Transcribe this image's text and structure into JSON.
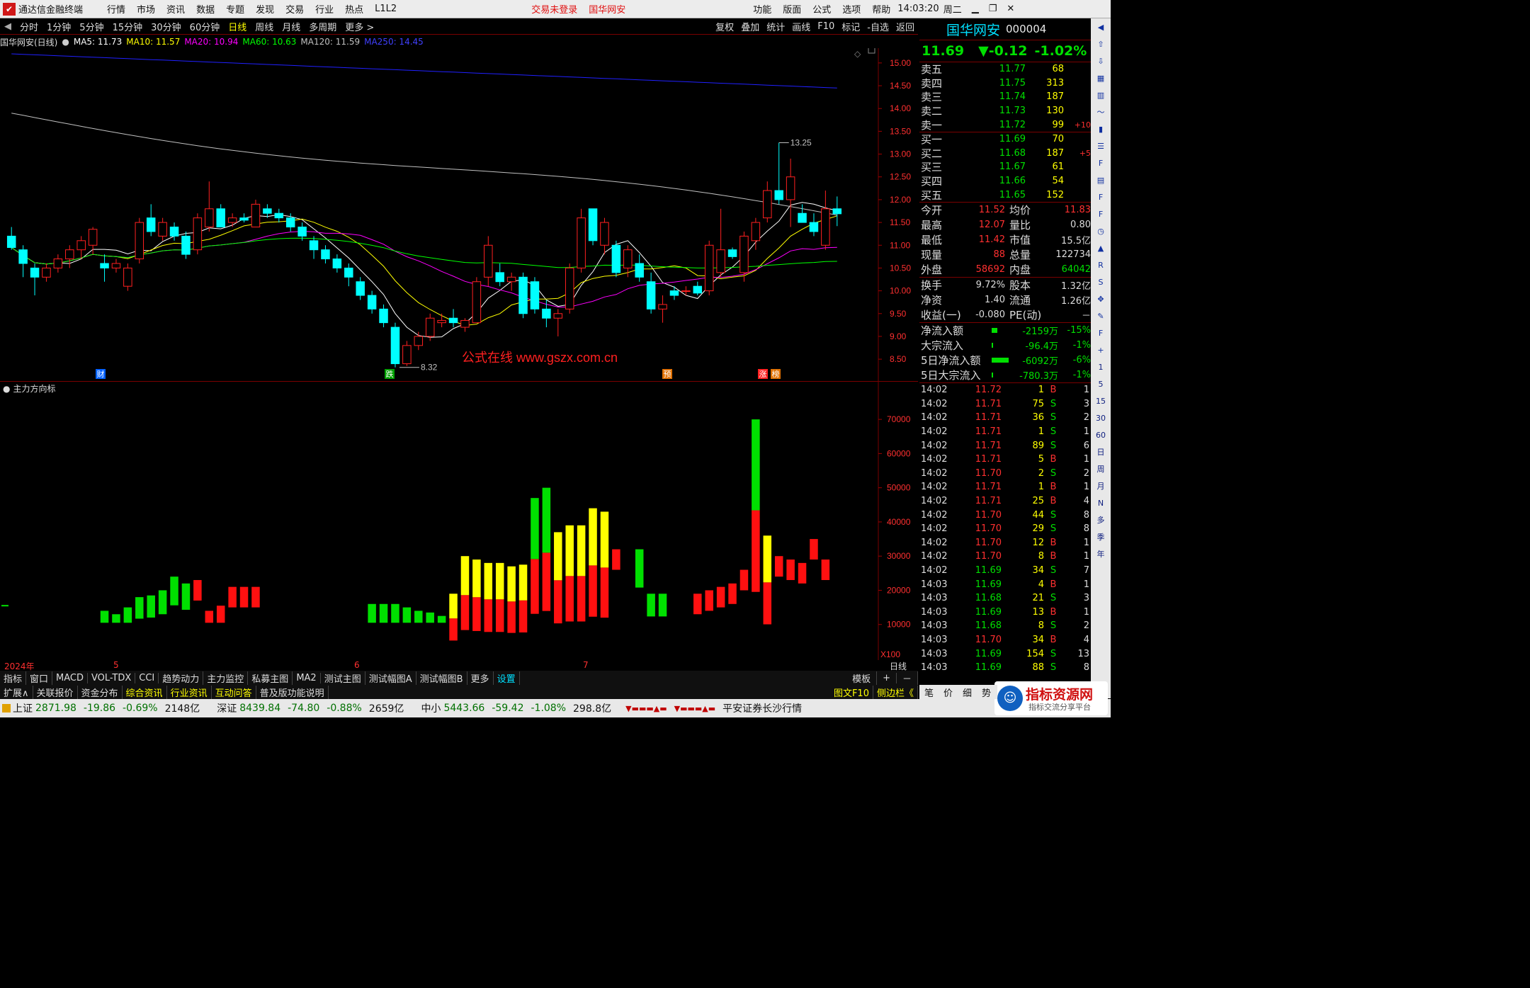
{
  "menubar": {
    "app_title": "通达信金融终端",
    "items": [
      "行情",
      "市场",
      "资讯",
      "数据",
      "专题",
      "发现",
      "交易",
      "行业",
      "热点",
      "L1L2"
    ],
    "warn1": "交易未登录",
    "warn2": "国华网安",
    "right_items": [
      "功能",
      "版面",
      "公式",
      "选项",
      "帮助"
    ],
    "time": "14:03:20",
    "weekday": "周二"
  },
  "toolbar": {
    "periods": [
      "分时",
      "1分钟",
      "5分钟",
      "15分钟",
      "30分钟",
      "60分钟",
      "日线",
      "周线",
      "月线",
      "多周期",
      "更多 >"
    ],
    "active": "日线",
    "right": [
      "复权",
      "叠加",
      "统计",
      "画线",
      "F10",
      "标记",
      "-自选",
      "返回"
    ]
  },
  "ma_line": {
    "title": "国华网安(日线)",
    "ma5": "MA5: 11.73",
    "ma10": "MA10: 11.57",
    "ma20": "MA20: 10.94",
    "ma60": "MA60: 10.63",
    "ma120": "MA120: 11.59",
    "ma250": "MA250: 14.45"
  },
  "colors": {
    "ma5": "#ffffff",
    "ma10": "#ffff00",
    "ma20": "#ff00ff",
    "ma60": "#00ff00",
    "ma120": "#c0c0c0",
    "ma250": "#2020ff",
    "up": "#ff2020",
    "down": "#00ffff"
  },
  "annotations": {
    "high": "13.25",
    "low": "8.32",
    "watermark": "公式在线  www.gszx.com.cn",
    "events": [
      "财",
      "跌",
      "预",
      "涨",
      "榜"
    ]
  },
  "price_axis": [
    "15.00",
    "14.50",
    "14.00",
    "13.50",
    "13.00",
    "12.50",
    "12.00",
    "11.50",
    "11.00",
    "10.50",
    "10.00",
    "9.50",
    "9.00",
    "8.50"
  ],
  "indicator": {
    "title": "主力方向标",
    "axis": [
      "70000",
      "60000",
      "50000",
      "40000",
      "30000",
      "20000",
      "10000"
    ],
    "multiplier": "X100"
  },
  "date_axis": [
    "2024年",
    "5",
    "6",
    "7"
  ],
  "date_axis_right": "日线",
  "stock": {
    "name": "国华网安",
    "code": "000004",
    "price": "11.69",
    "change": "▼-0.12",
    "pct": "-1.02%"
  },
  "asks": [
    {
      "label": "卖五",
      "price": "11.77",
      "vol": "68",
      "chg": ""
    },
    {
      "label": "卖四",
      "price": "11.75",
      "vol": "313",
      "chg": ""
    },
    {
      "label": "卖三",
      "price": "11.74",
      "vol": "187",
      "chg": ""
    },
    {
      "label": "卖二",
      "price": "11.73",
      "vol": "130",
      "chg": ""
    },
    {
      "label": "卖一",
      "price": "11.72",
      "vol": "99",
      "chg": "+10"
    }
  ],
  "bids": [
    {
      "label": "买一",
      "price": "11.69",
      "vol": "70",
      "chg": ""
    },
    {
      "label": "买二",
      "price": "11.68",
      "vol": "187",
      "chg": "+5"
    },
    {
      "label": "买三",
      "price": "11.67",
      "vol": "61",
      "chg": ""
    },
    {
      "label": "买四",
      "price": "11.66",
      "vol": "54",
      "chg": ""
    },
    {
      "label": "买五",
      "price": "11.65",
      "vol": "152",
      "chg": ""
    }
  ],
  "stats": [
    {
      "l1": "今开",
      "v1": "11.52",
      "l2": "均价",
      "v2": "11.83"
    },
    {
      "l1": "最高",
      "v1": "12.07",
      "l2": "量比",
      "v2": "0.80"
    },
    {
      "l1": "最低",
      "v1": "11.42",
      "l2": "市值",
      "v2": "15.5亿"
    },
    {
      "l1": "现量",
      "v1": "88",
      "l2": "总量",
      "v2": "122734"
    },
    {
      "l1": "外盘",
      "v1": "58692",
      "l2": "内盘",
      "v2": "64042"
    }
  ],
  "stats2": [
    {
      "l1": "换手",
      "v1": "9.72%",
      "l2": "股本",
      "v2": "1.32亿"
    },
    {
      "l1": "净资",
      "v1": "1.40",
      "l2": "流通",
      "v2": "1.26亿"
    },
    {
      "l1": "收益(一)",
      "v1": "-0.080",
      "l2": "PE(动)",
      "v2": "－"
    }
  ],
  "flows": [
    {
      "label": "净流入额",
      "value": "-2159万",
      "pct": "-15%"
    },
    {
      "label": "大宗流入",
      "value": "-96.4万",
      "pct": "-1%"
    },
    {
      "label": "5日净流入额",
      "value": "-6092万",
      "pct": "-6%"
    },
    {
      "label": "5日大宗流入",
      "value": "-780.3万",
      "pct": "-1%"
    }
  ],
  "trades": [
    {
      "t": "14:02",
      "p": "11.72",
      "v": "1",
      "s": "B",
      "n": "1"
    },
    {
      "t": "14:02",
      "p": "11.71",
      "v": "75",
      "s": "S",
      "n": "3"
    },
    {
      "t": "14:02",
      "p": "11.71",
      "v": "36",
      "s": "S",
      "n": "2"
    },
    {
      "t": "14:02",
      "p": "11.71",
      "v": "1",
      "s": "S",
      "n": "1"
    },
    {
      "t": "14:02",
      "p": "11.71",
      "v": "89",
      "s": "S",
      "n": "6"
    },
    {
      "t": "14:02",
      "p": "11.71",
      "v": "5",
      "s": "B",
      "n": "1"
    },
    {
      "t": "14:02",
      "p": "11.70",
      "v": "2",
      "s": "S",
      "n": "2"
    },
    {
      "t": "14:02",
      "p": "11.71",
      "v": "1",
      "s": "B",
      "n": "1"
    },
    {
      "t": "14:02",
      "p": "11.71",
      "v": "25",
      "s": "B",
      "n": "4"
    },
    {
      "t": "14:02",
      "p": "11.70",
      "v": "44",
      "s": "S",
      "n": "8"
    },
    {
      "t": "14:02",
      "p": "11.70",
      "v": "29",
      "s": "S",
      "n": "8"
    },
    {
      "t": "14:02",
      "p": "11.70",
      "v": "12",
      "s": "B",
      "n": "1"
    },
    {
      "t": "14:02",
      "p": "11.70",
      "v": "8",
      "s": "B",
      "n": "1"
    },
    {
      "t": "14:02",
      "p": "11.69",
      "v": "34",
      "s": "S",
      "n": "7"
    },
    {
      "t": "14:03",
      "p": "11.69",
      "v": "4",
      "s": "B",
      "n": "1"
    },
    {
      "t": "14:03",
      "p": "11.68",
      "v": "21",
      "s": "S",
      "n": "3"
    },
    {
      "t": "14:03",
      "p": "11.69",
      "v": "13",
      "s": "B",
      "n": "1"
    },
    {
      "t": "14:03",
      "p": "11.68",
      "v": "8",
      "s": "S",
      "n": "2"
    },
    {
      "t": "14:03",
      "p": "11.70",
      "v": "34",
      "s": "B",
      "n": "4"
    },
    {
      "t": "14:03",
      "p": "11.69",
      "v": "154",
      "s": "S",
      "n": "13"
    },
    {
      "t": "14:03",
      "p": "11.69",
      "v": "88",
      "s": "S",
      "n": "8"
    }
  ],
  "bottom_tabs": [
    "指标",
    "窗口",
    "MACD",
    "VOL-TDX",
    "CCI",
    "趋势动力",
    "主力监控",
    "私募主图",
    "MA2",
    "测试主图",
    "测试幅图A",
    "测试幅图B",
    "更多",
    "设置"
  ],
  "bottom_tabs_right": [
    "模板",
    "+",
    "－"
  ],
  "bottom_tabs2": [
    "扩展∧",
    "关联报价",
    "资金分布",
    "综合资讯",
    "行业资讯",
    "互动问答",
    "普及版功能说明"
  ],
  "bottom_tabs2_right": [
    "图文F10",
    "侧边栏《",
    "笔",
    "价",
    "细",
    "势"
  ],
  "status": {
    "sh_label": "上证",
    "sh_val": "2871.98",
    "sh_chg": "-19.86",
    "sh_pct": "-0.69%",
    "sh_amt": "2148亿",
    "sz_label": "深证",
    "sz_val": "8439.84",
    "sz_chg": "-74.80",
    "sz_pct": "-0.88%",
    "sz_amt": "2659亿",
    "zx_label": "中小",
    "zx_val": "5443.66",
    "zx_chg": "-59.42",
    "zx_pct": "-1.08%",
    "zx_amt": "298.8亿",
    "broker": "平安证券长沙行情",
    "logo": "指标资源网",
    "logo_sub": "指标交流分享平台"
  },
  "sidebar_icons": [
    "collapse-icon",
    "up-icon",
    "down-icon",
    "grid-icon",
    "bars-icon",
    "line-icon",
    "candle-icon",
    "list-icon",
    "f10-icon",
    "doc-icon",
    "f-icon",
    "fz-icon",
    "clock-icon",
    "chart-icon",
    "rsi-icon",
    "s-icon",
    "move-icon",
    "pen-icon",
    "fs-icon",
    "plus-icon"
  ],
  "sidebar_periods": [
    "1",
    "5",
    "15",
    "30",
    "60",
    "日",
    "周",
    "月",
    "N",
    "多",
    "季",
    "年"
  ],
  "chart_data": {
    "type": "candlestick",
    "title": "国华网安(日线)",
    "ylim": [
      8.3,
      15.2
    ],
    "candles": [
      [
        11.2,
        11.4,
        10.9,
        10.95
      ],
      [
        10.9,
        11.0,
        10.3,
        10.6
      ],
      [
        10.5,
        10.6,
        9.9,
        10.3
      ],
      [
        10.3,
        10.6,
        10.2,
        10.5
      ],
      [
        10.5,
        10.8,
        10.4,
        10.7
      ],
      [
        10.7,
        11.0,
        10.5,
        10.9
      ],
      [
        10.9,
        11.2,
        10.7,
        11.1
      ],
      [
        11.0,
        11.4,
        10.8,
        11.35
      ],
      [
        10.6,
        10.8,
        10.2,
        10.5
      ],
      [
        10.5,
        10.7,
        10.4,
        10.6
      ],
      [
        10.1,
        10.6,
        10.0,
        10.5
      ],
      [
        10.7,
        11.6,
        10.6,
        11.5
      ],
      [
        11.6,
        11.9,
        11.2,
        11.3
      ],
      [
        11.2,
        11.6,
        11.1,
        11.5
      ],
      [
        11.4,
        11.5,
        11.1,
        11.2
      ],
      [
        11.2,
        11.3,
        10.7,
        10.8
      ],
      [
        10.9,
        11.7,
        10.8,
        11.6
      ],
      [
        11.4,
        12.4,
        11.3,
        11.8
      ],
      [
        11.8,
        11.9,
        11.5,
        11.4
      ],
      [
        11.5,
        11.7,
        11.4,
        11.6
      ],
      [
        11.6,
        11.7,
        11.5,
        11.55
      ],
      [
        11.4,
        12.0,
        11.4,
        11.9
      ],
      [
        11.8,
        11.9,
        11.6,
        11.7
      ],
      [
        11.7,
        11.8,
        11.5,
        11.6
      ],
      [
        11.6,
        11.7,
        11.3,
        11.4
      ],
      [
        11.4,
        11.5,
        11.1,
        11.2
      ],
      [
        11.1,
        11.2,
        10.7,
        10.9
      ],
      [
        10.9,
        11.0,
        10.6,
        10.7
      ],
      [
        10.7,
        10.8,
        10.4,
        10.5
      ],
      [
        10.5,
        10.6,
        10.1,
        10.3
      ],
      [
        10.2,
        10.3,
        9.8,
        9.9
      ],
      [
        9.9,
        10.0,
        9.5,
        9.6
      ],
      [
        9.6,
        9.7,
        9.2,
        9.3
      ],
      [
        9.2,
        9.3,
        8.32,
        8.4
      ],
      [
        8.4,
        8.9,
        8.35,
        8.8
      ],
      [
        8.8,
        9.1,
        8.7,
        9.0
      ],
      [
        9.0,
        9.5,
        8.9,
        9.4
      ],
      [
        9.3,
        9.5,
        9.2,
        9.35
      ],
      [
        9.4,
        9.6,
        9.2,
        9.3
      ],
      [
        9.2,
        9.4,
        9.1,
        9.35
      ],
      [
        9.3,
        10.3,
        9.3,
        10.2
      ],
      [
        10.3,
        11.2,
        10.1,
        11.0
      ],
      [
        10.4,
        10.6,
        10.1,
        10.2
      ],
      [
        10.2,
        10.4,
        10.0,
        10.3
      ],
      [
        10.3,
        10.4,
        9.4,
        9.5
      ],
      [
        10.2,
        10.3,
        9.5,
        9.6
      ],
      [
        9.6,
        9.8,
        9.2,
        9.4
      ],
      [
        9.4,
        9.6,
        9.0,
        9.5
      ],
      [
        9.6,
        10.6,
        9.5,
        10.5
      ],
      [
        10.5,
        11.8,
        10.4,
        11.6
      ],
      [
        11.8,
        11.8,
        11.0,
        11.1
      ],
      [
        11.0,
        11.6,
        10.8,
        11.5
      ],
      [
        11.0,
        11.1,
        10.3,
        10.4
      ],
      [
        10.5,
        11.0,
        10.3,
        10.9
      ],
      [
        10.6,
        10.8,
        10.2,
        10.3
      ],
      [
        10.2,
        10.4,
        9.5,
        9.6
      ],
      [
        9.6,
        9.9,
        9.3,
        9.7
      ],
      [
        10.0,
        10.1,
        9.8,
        9.9
      ],
      [
        10.0,
        10.1,
        9.9,
        10.0
      ],
      [
        10.1,
        10.2,
        9.9,
        9.95
      ],
      [
        10.0,
        11.1,
        9.9,
        11.0
      ],
      [
        10.4,
        11.8,
        10.3,
        10.9
      ],
      [
        10.9,
        10.95,
        10.7,
        10.75
      ],
      [
        10.4,
        11.3,
        10.2,
        11.2
      ],
      [
        11.1,
        11.6,
        10.9,
        11.5
      ],
      [
        11.6,
        12.4,
        11.5,
        12.2
      ],
      [
        12.2,
        13.25,
        11.9,
        12.0
      ],
      [
        12.0,
        12.9,
        11.4,
        12.5
      ],
      [
        11.7,
        11.9,
        11.5,
        11.5
      ],
      [
        11.5,
        11.7,
        11.2,
        11.3
      ],
      [
        11.0,
        12.2,
        10.9,
        11.8
      ],
      [
        11.8,
        12.07,
        11.42,
        11.69
      ]
    ]
  },
  "indicator_data": {
    "type": "bar",
    "ylim": [
      0,
      75000
    ],
    "bars": [
      [
        0,
        0,
        "none"
      ],
      [
        0,
        0,
        "none"
      ],
      [
        0,
        0,
        "none"
      ],
      [
        0,
        0,
        "none"
      ],
      [
        0,
        0,
        "none"
      ],
      [
        0,
        0,
        "none"
      ],
      [
        0,
        0,
        "none"
      ],
      [
        0,
        0,
        "none"
      ],
      [
        0,
        14000,
        "green"
      ],
      [
        0,
        13000,
        "green"
      ],
      [
        0,
        15000,
        "green"
      ],
      [
        0,
        18000,
        "green"
      ],
      [
        0,
        18500,
        "green"
      ],
      [
        0,
        20000,
        "green"
      ],
      [
        0,
        24000,
        "green"
      ],
      [
        0,
        22000,
        "green"
      ],
      [
        0,
        23000,
        "red"
      ],
      [
        0,
        14000,
        "red"
      ],
      [
        0,
        15500,
        "red"
      ],
      [
        0,
        21000,
        "red"
      ],
      [
        0,
        21000,
        "red"
      ],
      [
        0,
        21000,
        "red"
      ],
      [
        0,
        0,
        "none"
      ],
      [
        0,
        0,
        "none"
      ],
      [
        0,
        0,
        "none"
      ],
      [
        0,
        0,
        "none"
      ],
      [
        0,
        0,
        "none"
      ],
      [
        0,
        0,
        "none"
      ],
      [
        0,
        0,
        "none"
      ],
      [
        0,
        0,
        "none"
      ],
      [
        0,
        0,
        "none"
      ],
      [
        0,
        16000,
        "green"
      ],
      [
        0,
        16000,
        "green"
      ],
      [
        0,
        16000,
        "green"
      ],
      [
        0,
        15000,
        "green"
      ],
      [
        0,
        14000,
        "green"
      ],
      [
        0,
        13500,
        "green"
      ],
      [
        0,
        12500,
        "green"
      ],
      [
        0,
        19000,
        "red-yellow"
      ],
      [
        0,
        30000,
        "red-yellow"
      ],
      [
        0,
        29000,
        "red-yellow"
      ],
      [
        0,
        28000,
        "red-yellow"
      ],
      [
        0,
        28000,
        "red-yellow"
      ],
      [
        0,
        27000,
        "red-yellow"
      ],
      [
        0,
        27500,
        "red-yellow"
      ],
      [
        0,
        47000,
        "red-green"
      ],
      [
        0,
        50000,
        "red-green"
      ],
      [
        0,
        37000,
        "red-yellow"
      ],
      [
        0,
        39000,
        "red-yellow"
      ],
      [
        0,
        39000,
        "red-yellow"
      ],
      [
        0,
        44000,
        "red-yellow"
      ],
      [
        0,
        43000,
        "red-yellow"
      ],
      [
        0,
        32000,
        "red"
      ],
      [
        0,
        0,
        "none"
      ],
      [
        0,
        32000,
        "green"
      ],
      [
        0,
        19000,
        "green"
      ],
      [
        0,
        19000,
        "green"
      ],
      [
        0,
        0,
        "none"
      ],
      [
        0,
        0,
        "none"
      ],
      [
        0,
        19000,
        "red"
      ],
      [
        0,
        20000,
        "red"
      ],
      [
        0,
        21000,
        "red"
      ],
      [
        0,
        22000,
        "red"
      ],
      [
        0,
        26000,
        "red"
      ],
      [
        0,
        70000,
        "red-green"
      ],
      [
        0,
        36000,
        "red-yellow"
      ],
      [
        0,
        30000,
        "red"
      ],
      [
        0,
        29000,
        "red"
      ],
      [
        0,
        28000,
        "red"
      ],
      [
        0,
        35000,
        "red"
      ],
      [
        0,
        29000,
        "red"
      ]
    ]
  }
}
